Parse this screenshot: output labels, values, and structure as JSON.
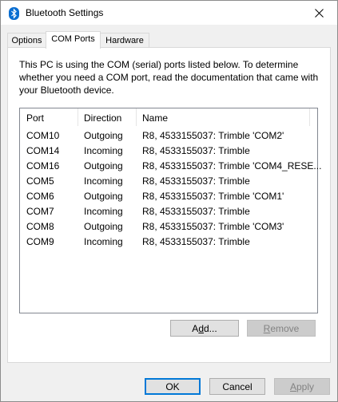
{
  "window": {
    "title": "Bluetooth Settings"
  },
  "tabs": [
    {
      "label": "Options"
    },
    {
      "label": "COM Ports"
    },
    {
      "label": "Hardware"
    }
  ],
  "description": "This PC is using the COM (serial) ports listed below. To determine whether you need a COM port, read the documentation that came with your Bluetooth device.",
  "list": {
    "columns": [
      "Port",
      "Direction",
      "Name"
    ],
    "rows": [
      {
        "port": "COM10",
        "direction": "Outgoing",
        "name": "R8, 4533155037: Trimble 'COM2'"
      },
      {
        "port": "COM14",
        "direction": "Incoming",
        "name": "R8, 4533155037: Trimble"
      },
      {
        "port": "COM16",
        "direction": "Outgoing",
        "name": "R8, 4533155037: Trimble 'COM4_RESE..."
      },
      {
        "port": "COM5",
        "direction": "Incoming",
        "name": "R8, 4533155037: Trimble"
      },
      {
        "port": "COM6",
        "direction": "Outgoing",
        "name": "R8, 4533155037: Trimble 'COM1'"
      },
      {
        "port": "COM7",
        "direction": "Incoming",
        "name": "R8, 4533155037: Trimble"
      },
      {
        "port": "COM8",
        "direction": "Outgoing",
        "name": "R8, 4533155037: Trimble 'COM3'"
      },
      {
        "port": "COM9",
        "direction": "Incoming",
        "name": "R8, 4533155037: Trimble"
      }
    ]
  },
  "buttons": {
    "add": {
      "pre": "A",
      "accel": "d",
      "post": "d..."
    },
    "remove": {
      "accel": "R",
      "post": "emove"
    },
    "ok": "OK",
    "cancel": "Cancel",
    "apply": {
      "accel": "A",
      "post": "pply"
    }
  },
  "colors": {
    "accent": "#0078d7",
    "bluetooth_icon": "#0a6ed1"
  }
}
